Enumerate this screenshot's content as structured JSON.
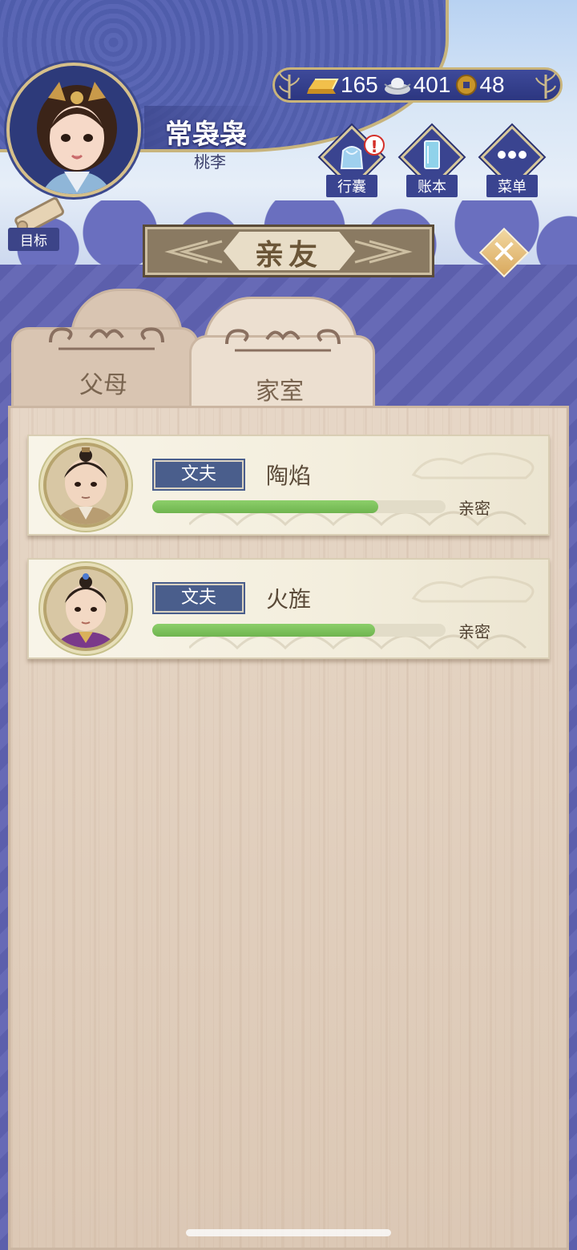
{
  "player": {
    "name": "常袅袅",
    "title": "桃李"
  },
  "goal": {
    "label": "目标"
  },
  "currency": {
    "gold": "165",
    "silver": "401",
    "coins": "48"
  },
  "menu": {
    "bag_label": "行囊",
    "bag_alert": "!",
    "ledger_label": "账本",
    "menu_label": "菜单"
  },
  "dialog": {
    "title": "亲友",
    "close_icon": "close-icon"
  },
  "tabs": [
    {
      "label": "父母",
      "active": false
    },
    {
      "label": "家室",
      "active": true
    }
  ],
  "relations": [
    {
      "relation": "文夫",
      "name": "陶焰",
      "intimacy_label": "亲密",
      "intimacy": 0.77
    },
    {
      "relation": "文夫",
      "name": "火旌",
      "intimacy_label": "亲密",
      "intimacy": 0.76
    }
  ],
  "colors": {
    "accent_purple": "#5f62b2",
    "tag_blue": "#4a5e8c",
    "bar_green": "#7ec15c",
    "gold_trim": "#c9b47a"
  }
}
